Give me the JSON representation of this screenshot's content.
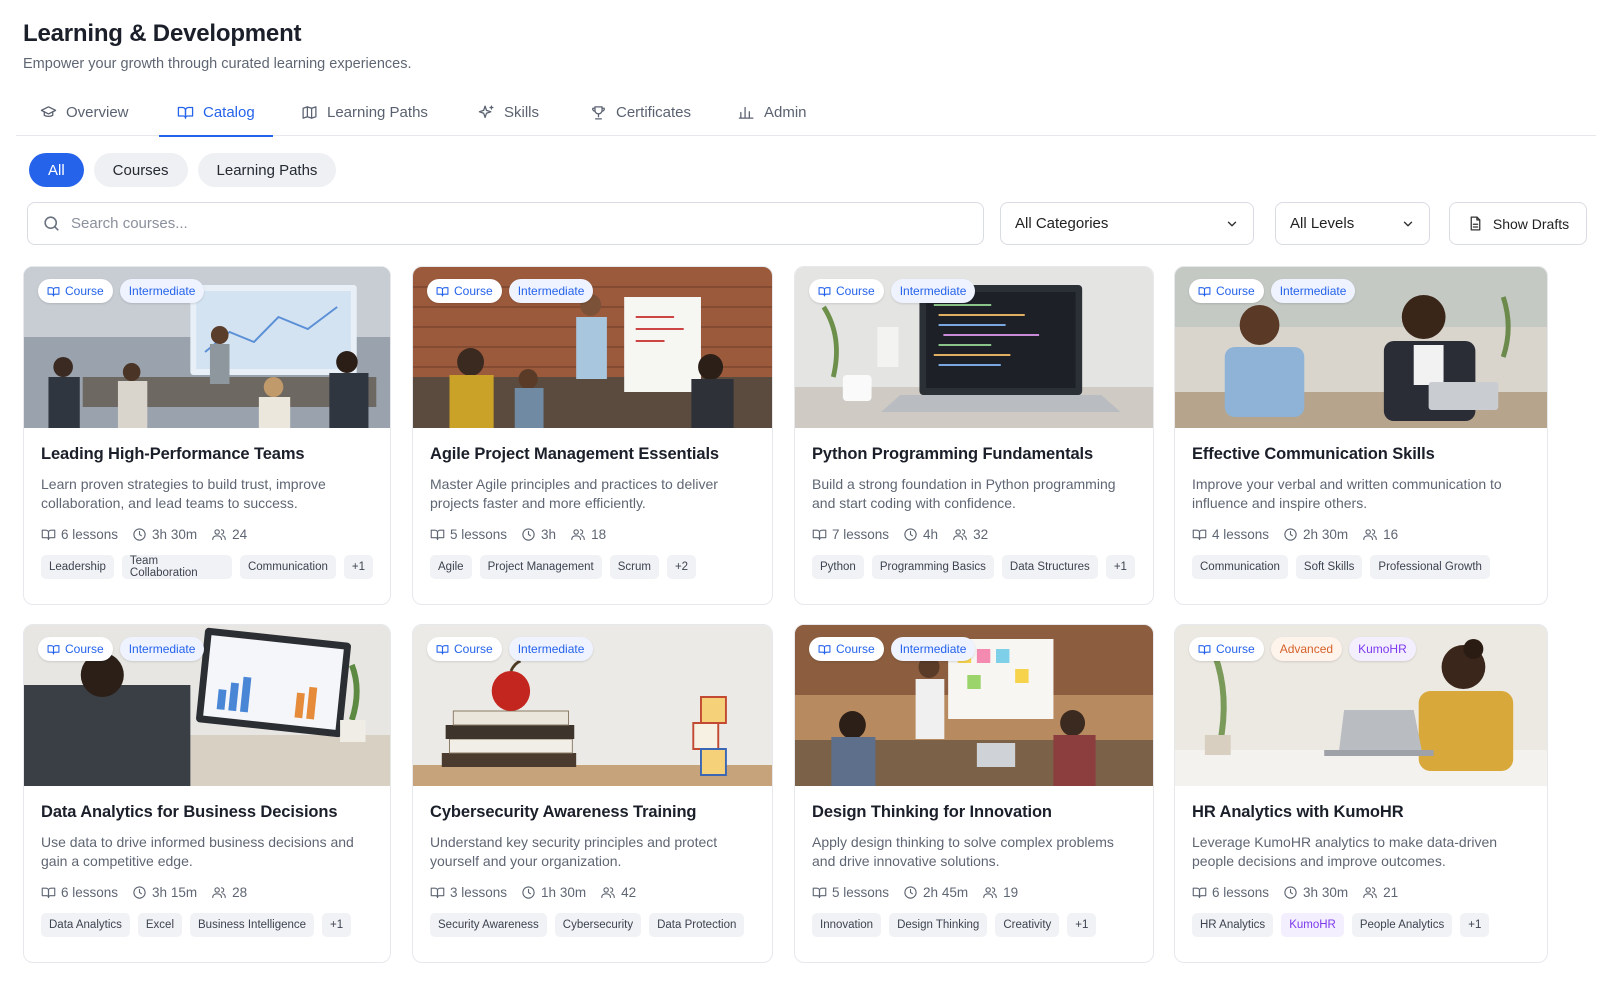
{
  "header": {
    "title": "Learning & Development",
    "subtitle": "Empower your growth through curated learning experiences."
  },
  "tabs": [
    {
      "label": "Overview",
      "icon": "graduation-cap-icon"
    },
    {
      "label": "Catalog",
      "icon": "book-open-icon",
      "active": true
    },
    {
      "label": "Learning Paths",
      "icon": "map-icon"
    },
    {
      "label": "Skills",
      "icon": "sparkles-icon"
    },
    {
      "label": "Certificates",
      "icon": "trophy-icon"
    },
    {
      "label": "Admin",
      "icon": "bar-chart-icon"
    }
  ],
  "filters": {
    "pills": [
      "All",
      "Courses",
      "Learning Paths"
    ],
    "active_pill": "All",
    "search_placeholder": "Search courses...",
    "category_select": "All Categories",
    "level_select": "All Levels",
    "drafts_label": "Show Drafts"
  },
  "colors": {
    "accent": "#2563eb",
    "advanced": "#d4622a",
    "kumohr": "#7c3aed"
  },
  "courses": [
    {
      "type": "Course",
      "level": "Intermediate",
      "title": "Leading High-Performance Teams",
      "desc": "Learn proven strategies to build trust, improve collaboration, and lead teams to success.",
      "lessons": "6 lessons",
      "duration": "3h 30m",
      "learners": "24",
      "tags": [
        "Leadership",
        "Team Collaboration",
        "Communication",
        "+1"
      ]
    },
    {
      "type": "Course",
      "level": "Intermediate",
      "title": "Agile Project Management Essentials",
      "desc": "Master Agile principles and practices to deliver projects faster and more efficiently.",
      "lessons": "5 lessons",
      "duration": "3h",
      "learners": "18",
      "tags": [
        "Agile",
        "Project Management",
        "Scrum",
        "+2"
      ]
    },
    {
      "type": "Course",
      "level": "Intermediate",
      "title": "Python Programming Fundamentals",
      "desc": "Build a strong foundation in Python programming and start coding with confidence.",
      "lessons": "7 lessons",
      "duration": "4h",
      "learners": "32",
      "tags": [
        "Python",
        "Programming Basics",
        "Data Structures",
        "+1"
      ]
    },
    {
      "type": "Course",
      "level": "Intermediate",
      "title": "Effective Communication Skills",
      "desc": "Improve your verbal and written communication to influence and inspire others.",
      "lessons": "4 lessons",
      "duration": "2h 30m",
      "learners": "16",
      "tags": [
        "Communication",
        "Soft Skills",
        "Professional Growth"
      ]
    },
    {
      "type": "Course",
      "level": "Intermediate",
      "title": "Data Analytics for Business Decisions",
      "desc": "Use data to drive informed business decisions and gain a competitive edge.",
      "lessons": "6 lessons",
      "duration": "3h 15m",
      "learners": "28",
      "tags": [
        "Data Analytics",
        "Excel",
        "Business Intelligence",
        "+1"
      ]
    },
    {
      "type": "Course",
      "level": "Intermediate",
      "title": "Cybersecurity Awareness Training",
      "desc": "Understand key security principles and protect yourself and your organization.",
      "lessons": "3 lessons",
      "duration": "1h 30m",
      "learners": "42",
      "tags": [
        "Security Awareness",
        "Cybersecurity",
        "Data Protection"
      ]
    },
    {
      "type": "Course",
      "level": "Intermediate",
      "title": "Design Thinking for Innovation",
      "desc": "Apply design thinking to solve complex problems and drive innovative solutions.",
      "lessons": "5 lessons",
      "duration": "2h 45m",
      "learners": "19",
      "tags": [
        "Innovation",
        "Design Thinking",
        "Creativity",
        "+1"
      ]
    },
    {
      "type": "Course",
      "level": "Advanced",
      "extra_badge": "KumoHR",
      "title": "HR Analytics with KumoHR",
      "desc": "Leverage KumoHR analytics to make data-driven people decisions and improve outcomes.",
      "lessons": "6 lessons",
      "duration": "3h 30m",
      "learners": "21",
      "tags": [
        "HR Analytics",
        "KumoHR",
        "People Analytics",
        "+1"
      ]
    }
  ]
}
